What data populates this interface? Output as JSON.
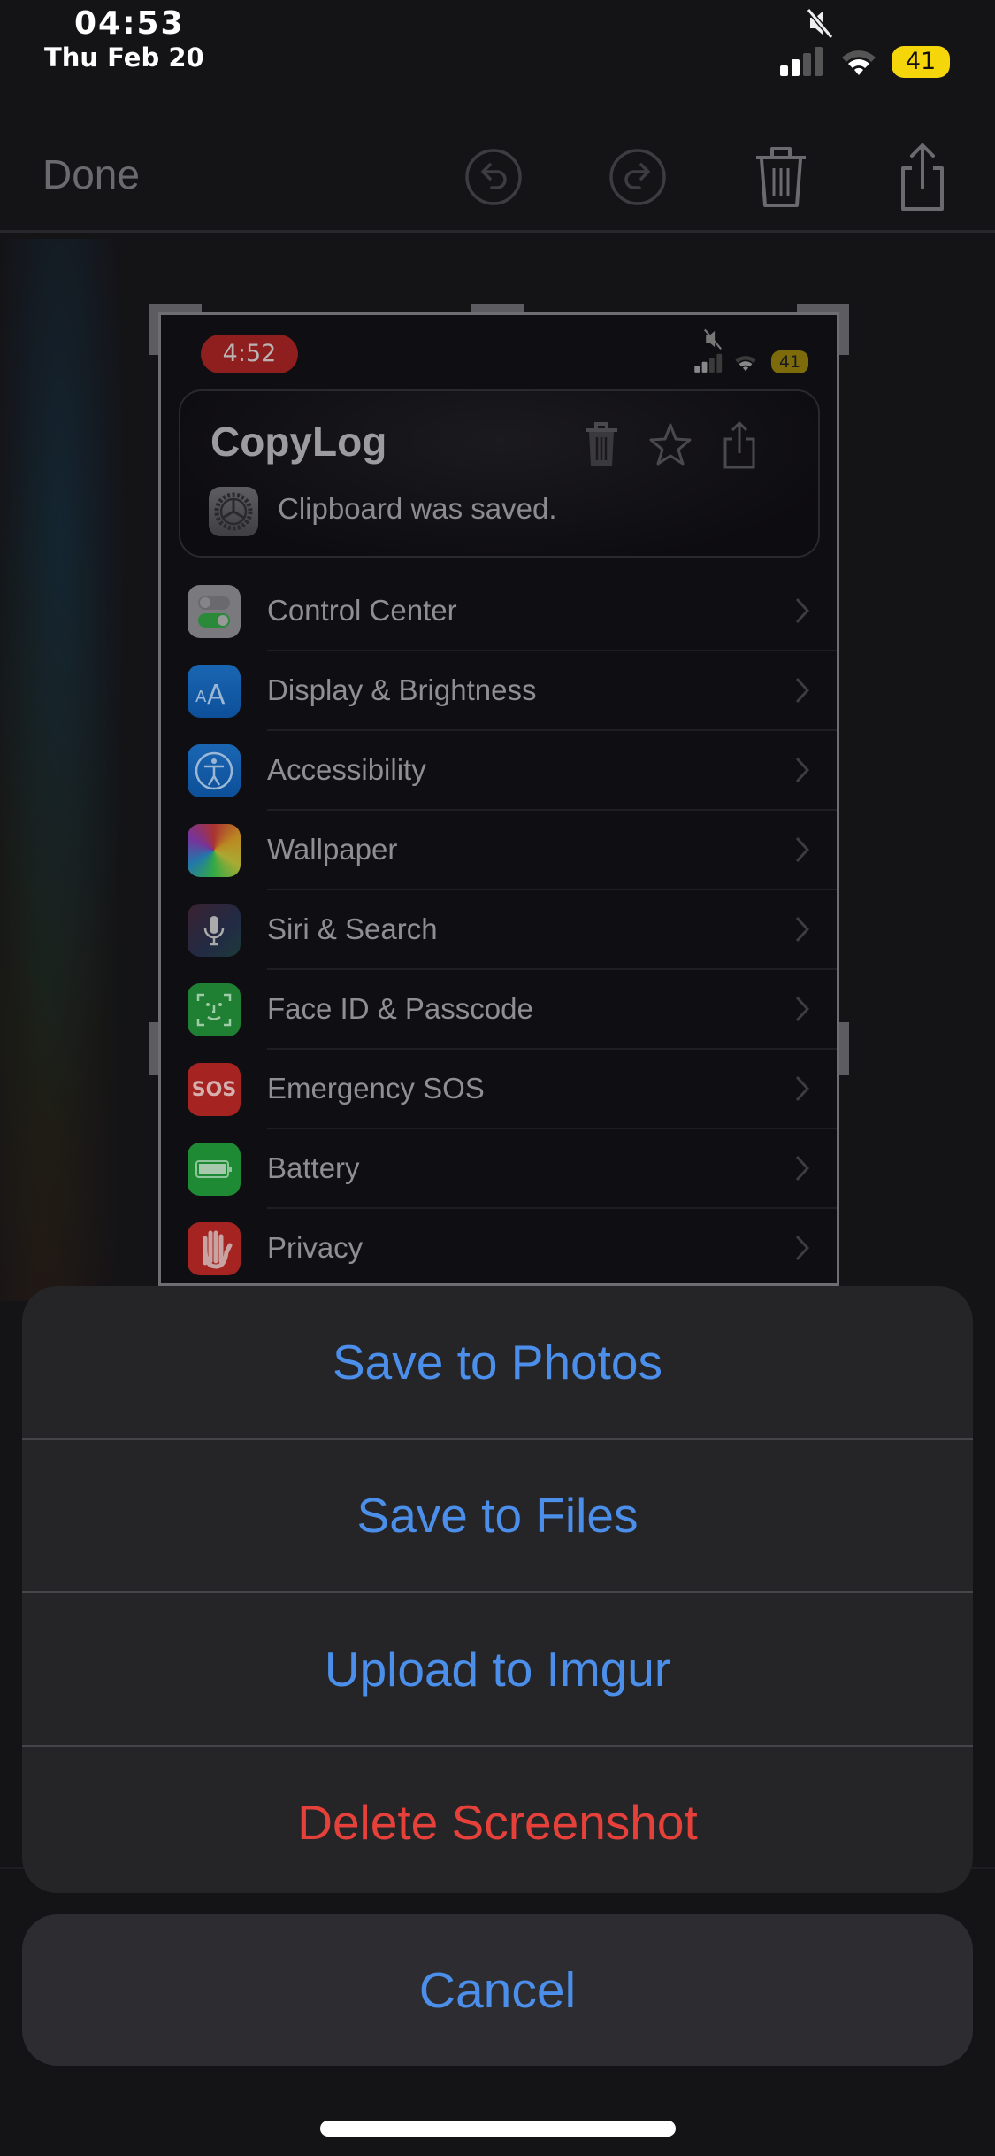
{
  "status_bar": {
    "time": "04:53",
    "date": "Thu Feb 20",
    "icons": [
      "mute-icon",
      "signal-icon",
      "wifi-icon"
    ],
    "battery_level": "41",
    "battery_color": "#f5d60a"
  },
  "toolbar": {
    "done_label": "Done",
    "icons": [
      "undo-icon",
      "redo-icon",
      "trash-icon",
      "share-icon"
    ]
  },
  "preview": {
    "status_bar": {
      "time": "4:52",
      "battery_level": "41"
    },
    "notification": {
      "app_name": "CopyLog",
      "message": "Clipboard was saved.",
      "actions": [
        "trash-icon",
        "star-icon",
        "share-icon"
      ]
    },
    "settings_items": [
      {
        "label": "Control Center",
        "icon": "control-center-icon"
      },
      {
        "label": "Display & Brightness",
        "icon": "display-brightness-icon"
      },
      {
        "label": "Accessibility",
        "icon": "accessibility-icon"
      },
      {
        "label": "Wallpaper",
        "icon": "wallpaper-icon"
      },
      {
        "label": "Siri & Search",
        "icon": "siri-icon"
      },
      {
        "label": "Face ID & Passcode",
        "icon": "face-id-icon"
      },
      {
        "label": "Emergency SOS",
        "icon": "sos-icon",
        "icon_text": "SOS"
      },
      {
        "label": "Battery",
        "icon": "battery-icon"
      },
      {
        "label": "Privacy",
        "icon": "privacy-hand-icon"
      }
    ]
  },
  "action_sheet": {
    "items": [
      {
        "label": "Save to Photos",
        "style": "default"
      },
      {
        "label": "Save to Files",
        "style": "default"
      },
      {
        "label": "Upload to Imgur",
        "style": "default"
      },
      {
        "label": "Delete Screenshot",
        "style": "destructive"
      }
    ],
    "cancel_label": "Cancel",
    "accent_color": "#4b8fea",
    "destructive_color": "#e5413a"
  }
}
